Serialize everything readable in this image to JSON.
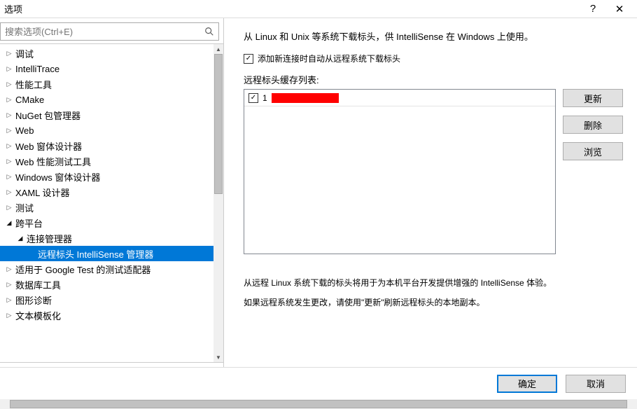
{
  "title": "选项",
  "search": {
    "placeholder": "搜索选项(Ctrl+E)"
  },
  "tree": [
    {
      "depth": 0,
      "expanded": false,
      "label": "调试"
    },
    {
      "depth": 0,
      "expanded": false,
      "label": "IntelliTrace"
    },
    {
      "depth": 0,
      "expanded": false,
      "label": "性能工具"
    },
    {
      "depth": 0,
      "expanded": false,
      "label": "CMake"
    },
    {
      "depth": 0,
      "expanded": false,
      "label": "NuGet 包管理器"
    },
    {
      "depth": 0,
      "expanded": false,
      "label": "Web"
    },
    {
      "depth": 0,
      "expanded": false,
      "label": "Web 窗体设计器"
    },
    {
      "depth": 0,
      "expanded": false,
      "label": "Web 性能测试工具"
    },
    {
      "depth": 0,
      "expanded": false,
      "label": "Windows 窗体设计器"
    },
    {
      "depth": 0,
      "expanded": false,
      "label": "XAML 设计器"
    },
    {
      "depth": 0,
      "expanded": false,
      "label": "测试"
    },
    {
      "depth": 0,
      "expanded": true,
      "label": "跨平台"
    },
    {
      "depth": 1,
      "expanded": true,
      "label": "连接管理器"
    },
    {
      "depth": 2,
      "expanded": null,
      "label": "远程标头 IntelliSense 管理器",
      "selected": true
    },
    {
      "depth": 0,
      "expanded": false,
      "label": "适用于 Google Test 的测试适配器"
    },
    {
      "depth": 0,
      "expanded": false,
      "label": "数据库工具"
    },
    {
      "depth": 0,
      "expanded": false,
      "label": "图形诊断"
    },
    {
      "depth": 0,
      "expanded": false,
      "label": "文本模板化"
    }
  ],
  "right": {
    "desc_top": "从 Linux 和 Unix 等系统下载标头，供 IntelliSense 在 Windows 上使用。",
    "auto_download_label": "添加新连接时自动从远程系统下载标头",
    "auto_download_checked": true,
    "list_label": "远程标头缓存列表:",
    "list_items": [
      {
        "checked": true,
        "text": "1",
        "redacted": true
      }
    ],
    "buttons": {
      "update": "更新",
      "delete": "删除",
      "browse": "浏览"
    },
    "desc_bottom_1": "从远程 Linux 系统下载的标头将用于为本机平台开发提供增强的 IntelliSense 体验。",
    "desc_bottom_2": "如果远程系统发生更改，请使用\"更新\"刷新远程标头的本地副本。"
  },
  "footer": {
    "ok": "确定",
    "cancel": "取消"
  }
}
